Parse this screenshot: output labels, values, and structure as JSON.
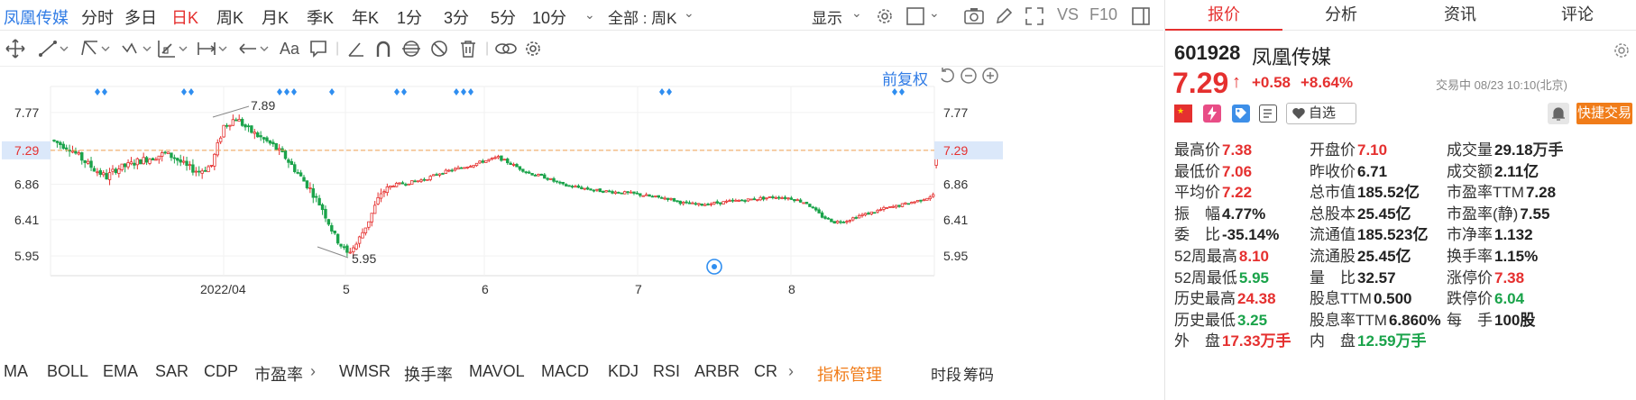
{
  "topbar": {
    "stock_name": "凤凰传媒",
    "periods": [
      "分时",
      "多日",
      "日K",
      "周K",
      "月K",
      "季K",
      "年K",
      "1分",
      "3分",
      "5分",
      "10分"
    ],
    "active_period": "日K",
    "range_select": "全部 : 周K",
    "display_label": "显示",
    "vs_label": "VS",
    "f10_label": "F10"
  },
  "drawbar": {
    "text_tool": "Aa"
  },
  "chart": {
    "adjust_label": "前复权",
    "reference_price": "7.29",
    "price_ticks": [
      "7.77",
      "7.29",
      "6.86",
      "6.41",
      "5.95"
    ],
    "max_annotation": "7.89",
    "min_annotation": "5.95",
    "x_labels": [
      "2022/04",
      "5",
      "6",
      "7",
      "8"
    ],
    "colors": {
      "up": "#e5302f",
      "down": "#1aa34a",
      "ref_line": "#f0a050",
      "marker": "#2f8ef0"
    }
  },
  "chart_data": {
    "type": "candlestick",
    "ylim": [
      5.7,
      8.1
    ],
    "y_ticks": [
      7.77,
      7.29,
      6.86,
      6.41,
      5.95
    ],
    "reference_line": 7.29,
    "annotations": [
      {
        "label": "7.89",
        "kind": "high"
      },
      {
        "label": "5.95",
        "kind": "low"
      }
    ],
    "x_tick_labels": [
      "2022/04",
      "5",
      "6",
      "7",
      "8"
    ],
    "last": {
      "open": 7.1,
      "high": 7.38,
      "low": 7.06,
      "close": 7.29
    }
  },
  "indicators": {
    "items": [
      "MA",
      "BOLL",
      "EMA",
      "SAR",
      "CDP",
      "市盈率",
      "WMSR",
      "换手率",
      "MAVOL",
      "MACD",
      "KDJ",
      "RSI",
      "ARBR",
      "CR"
    ],
    "manage_label": "指标管理",
    "right_items": [
      "时段",
      "筹码"
    ]
  },
  "panel": {
    "tabs": [
      "报价",
      "分析",
      "资讯",
      "评论"
    ],
    "active_tab": "报价",
    "code": "601928",
    "name": "凤凰传媒",
    "price": "7.29",
    "change": "+0.58",
    "change_pct": "+8.64%",
    "status": "交易中 08/23 10:10(北京)",
    "watch_label": "自选",
    "trade_label": "快捷交易",
    "rows": [
      [
        {
          "label": "最高价",
          "value": "7.38",
          "color": "up"
        },
        {
          "label": "开盘价",
          "value": "7.10",
          "color": "up"
        },
        {
          "label": "成交量",
          "value": "29.18",
          "unit": "万手",
          "color": "black"
        }
      ],
      [
        {
          "label": "最低价",
          "value": "7.06",
          "color": "up"
        },
        {
          "label": "昨收价",
          "value": "6.71",
          "color": "black"
        },
        {
          "label": "成交额",
          "value": "2.11亿",
          "color": "black"
        }
      ],
      [
        {
          "label": "平均价",
          "value": "7.22",
          "color": "up"
        },
        {
          "label": "总市值",
          "value": "185.52亿",
          "color": "black"
        },
        {
          "label": "市盈率TTM",
          "value": "7.28",
          "color": "black"
        }
      ],
      [
        {
          "label": "振　幅",
          "value": "4.77%",
          "color": "black"
        },
        {
          "label": "总股本",
          "value": "25.45亿",
          "color": "black"
        },
        {
          "label": "市盈率(静)",
          "value": "7.55",
          "color": "black"
        }
      ],
      [
        {
          "label": "委　比",
          "value": "-35.14%",
          "color": "black"
        },
        {
          "label": "流通值",
          "value": "185.523亿",
          "color": "black"
        },
        {
          "label": "市净率",
          "value": "1.132",
          "color": "black"
        }
      ],
      [
        {
          "label": "52周最高",
          "value": "8.10",
          "color": "up"
        },
        {
          "label": "流通股",
          "value": "25.45亿",
          "color": "black"
        },
        {
          "label": "换手率",
          "value": "1.15%",
          "color": "black"
        }
      ],
      [
        {
          "label": "52周最低",
          "value": "5.95",
          "color": "down"
        },
        {
          "label": "量　比",
          "value": "32.57",
          "color": "black"
        },
        {
          "label": "涨停价",
          "value": "7.38",
          "color": "up"
        }
      ],
      [
        {
          "label": "历史最高",
          "value": "24.38",
          "color": "up"
        },
        {
          "label": "股息TTM",
          "value": "0.500",
          "color": "black"
        },
        {
          "label": "跌停价",
          "value": "6.04",
          "color": "down"
        }
      ],
      [
        {
          "label": "历史最低",
          "value": "3.25",
          "color": "down"
        },
        {
          "label": "股息率TTM",
          "value": "6.860%",
          "color": "black"
        },
        {
          "label": "每　手",
          "value": "100股",
          "color": "black"
        }
      ],
      [
        {
          "label": "外　盘",
          "value": "17.33",
          "unit": "万手",
          "color": "up"
        },
        {
          "label": "内　盘",
          "value": "12.59",
          "unit": "万手",
          "color": "down"
        },
        {
          "label": "",
          "value": "",
          "color": "black"
        }
      ]
    ]
  }
}
